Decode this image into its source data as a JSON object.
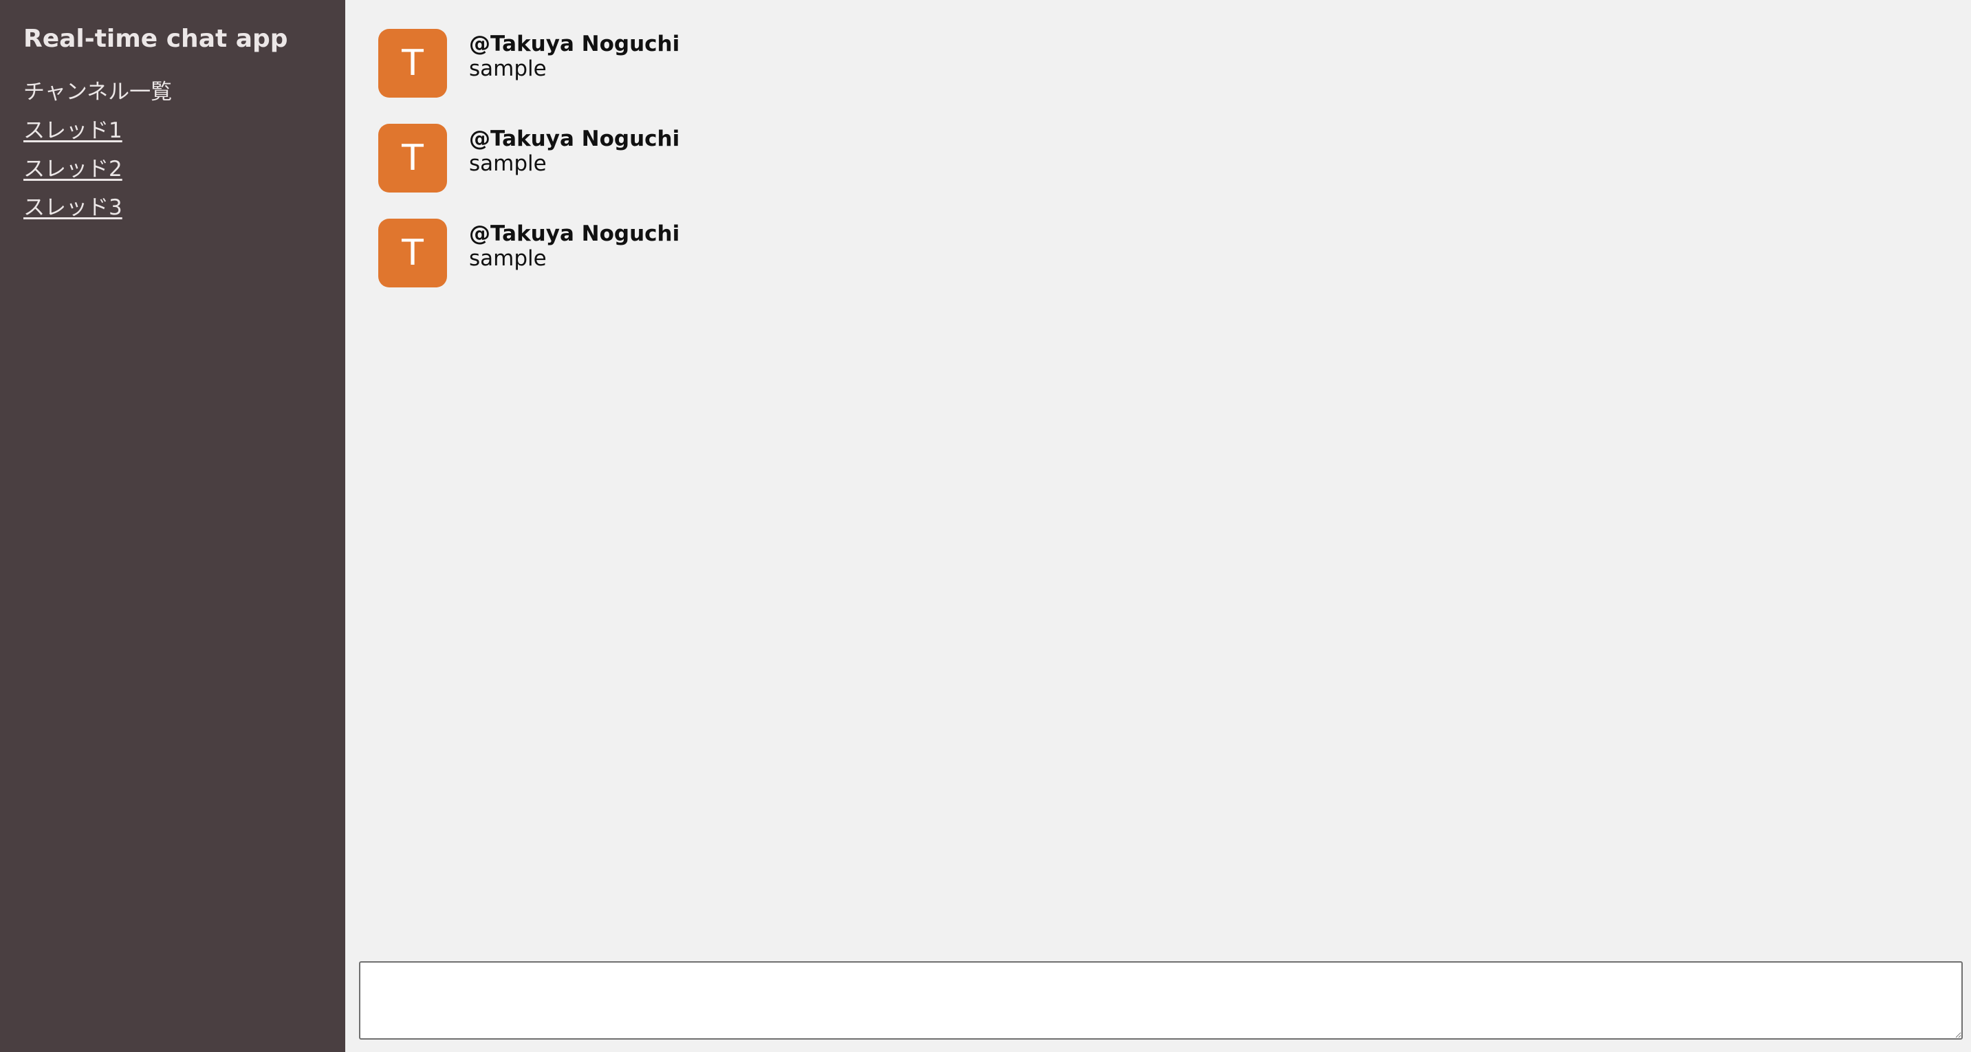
{
  "sidebar": {
    "app_title": "Real-time chat app",
    "channel_heading": "チャンネル一覧",
    "threads": [
      {
        "label": "スレッド1"
      },
      {
        "label": "スレッド2"
      },
      {
        "label": "スレッド3"
      }
    ]
  },
  "messages": [
    {
      "avatar_letter": "T",
      "user": "@Takuya Noguchi",
      "text": "sample"
    },
    {
      "avatar_letter": "T",
      "user": "@Takuya Noguchi",
      "text": "sample"
    },
    {
      "avatar_letter": "T",
      "user": "@Takuya Noguchi",
      "text": "sample"
    }
  ],
  "composer": {
    "value": "",
    "placeholder": ""
  },
  "colors": {
    "sidebar_bg": "#4a3f41",
    "main_bg": "#f1f1f1",
    "avatar_bg": "#e0762e"
  }
}
